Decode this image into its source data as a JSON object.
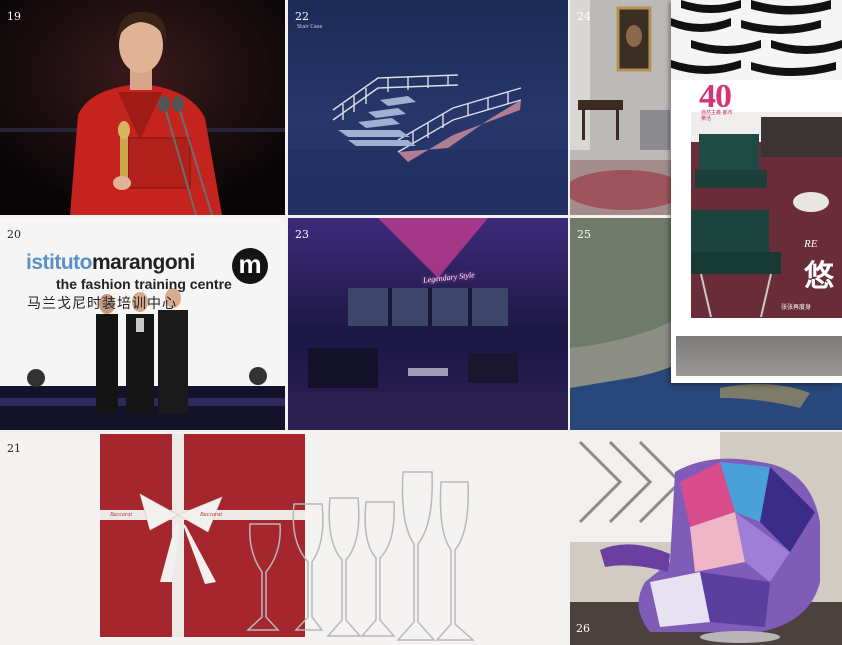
{
  "page": {
    "panels": [
      {
        "number": "19"
      },
      {
        "number": "22"
      },
      {
        "number": "24"
      },
      {
        "number": "20"
      },
      {
        "number": "23"
      },
      {
        "number": "25"
      },
      {
        "number": "21"
      },
      {
        "number": "26"
      }
    ]
  },
  "panel_22": {
    "caption": "Stair Case"
  },
  "panel_20": {
    "logo_part1": "istituto",
    "logo_part2": "marangoni",
    "tagline": "the fashion training centre",
    "chinese": "马兰戈尼时装培训中心",
    "badge": "m"
  },
  "panel_23": {
    "neon_sign": "Legendary Style"
  },
  "panel_21": {
    "brand_text": "Baccarat"
  },
  "magazine": {
    "issue_number": "40",
    "subtitle": "自然主義 都市樂活",
    "headline_latin": "RE",
    "headline_cn": "悠",
    "caption": "张张再度身"
  },
  "colors": {
    "magenta_accent": "#d4357a",
    "marangoni_blue": "#5b8fc7",
    "box_red": "#a5262c"
  }
}
